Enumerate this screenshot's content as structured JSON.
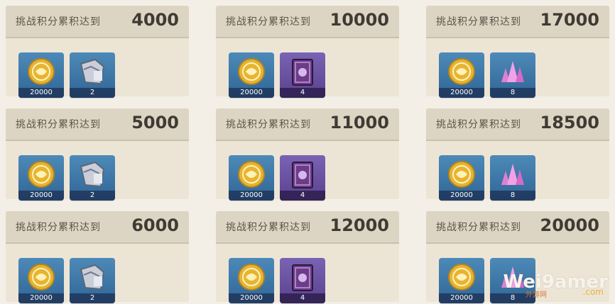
{
  "watermark": {
    "brand": "Wei9amer",
    "com": ".com",
    "sub": "外游网"
  },
  "cards": [
    {
      "label": "挑战积分累积达到",
      "value": "4000",
      "rewards": [
        {
          "icon": "mora-coin-icon",
          "qty": "20000",
          "bg": "blue"
        },
        {
          "icon": "weapon-ore-icon",
          "qty": "2",
          "bg": "blue"
        }
      ]
    },
    {
      "label": "挑战积分累积达到",
      "value": "10000",
      "rewards": [
        {
          "icon": "mora-coin-icon",
          "qty": "20000",
          "bg": "blue"
        },
        {
          "icon": "purple-book-icon",
          "qty": "4",
          "bg": "purple"
        }
      ]
    },
    {
      "label": "挑战积分累积达到",
      "value": "17000",
      "rewards": [
        {
          "icon": "mora-coin-icon",
          "qty": "20000",
          "bg": "blue"
        },
        {
          "icon": "pink-crystal-icon",
          "qty": "8",
          "bg": "blue"
        }
      ]
    },
    {
      "label": "挑战积分累积达到",
      "value": "5000",
      "rewards": [
        {
          "icon": "mora-coin-icon",
          "qty": "20000",
          "bg": "blue"
        },
        {
          "icon": "weapon-ore-icon",
          "qty": "2",
          "bg": "blue"
        }
      ]
    },
    {
      "label": "挑战积分累积达到",
      "value": "11000",
      "rewards": [
        {
          "icon": "mora-coin-icon",
          "qty": "20000",
          "bg": "blue"
        },
        {
          "icon": "purple-book-icon",
          "qty": "4",
          "bg": "purple"
        }
      ]
    },
    {
      "label": "挑战积分累积达到",
      "value": "18500",
      "rewards": [
        {
          "icon": "mora-coin-icon",
          "qty": "20000",
          "bg": "blue"
        },
        {
          "icon": "pink-crystal-icon",
          "qty": "8",
          "bg": "blue"
        }
      ]
    },
    {
      "label": "挑战积分累积达到",
      "value": "6000",
      "rewards": [
        {
          "icon": "mora-coin-icon",
          "qty": "20000",
          "bg": "blue"
        },
        {
          "icon": "weapon-ore-icon",
          "qty": "2",
          "bg": "blue"
        }
      ]
    },
    {
      "label": "挑战积分累积达到",
      "value": "12000",
      "rewards": [
        {
          "icon": "mora-coin-icon",
          "qty": "20000",
          "bg": "blue"
        },
        {
          "icon": "purple-book-icon",
          "qty": "4",
          "bg": "purple"
        }
      ]
    },
    {
      "label": "挑战积分累积达到",
      "value": "20000",
      "rewards": [
        {
          "icon": "mora-coin-icon",
          "qty": "20000",
          "bg": "blue"
        },
        {
          "icon": "pink-crystal-icon",
          "qty": "8",
          "bg": "blue"
        }
      ]
    }
  ]
}
